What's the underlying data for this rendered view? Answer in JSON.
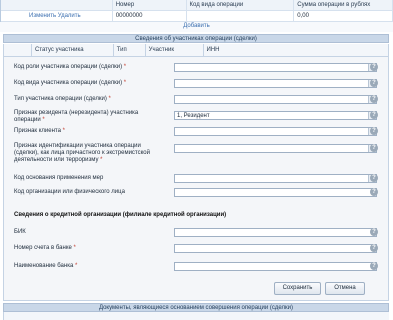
{
  "top_table": {
    "headers": [
      "",
      "Номер",
      "Код вида операции",
      "Сумма операции в рублях"
    ],
    "row": {
      "edit_link": "Изменить",
      "delete_link": "Удалить",
      "number": "00000000",
      "op_code": "",
      "amount": "0,00"
    }
  },
  "add_link": "Добавить",
  "participants_panel": {
    "title": "Сведения об участниках операции (сделки)",
    "columns": [
      "",
      "Статус участника",
      "Тип",
      "Участник",
      "ИНН"
    ]
  },
  "form": {
    "fields": [
      {
        "label": "Код роли участника операции (сделки)",
        "required": true,
        "type": "select",
        "value": ""
      },
      {
        "label": "Код вида участника операции (сделки)",
        "required": true,
        "type": "select",
        "value": ""
      },
      {
        "label": "Тип участника операции (сделки)",
        "required": true,
        "type": "select",
        "value": ""
      },
      {
        "label": "Признак резидента (нерезидента) участника операции",
        "required": true,
        "type": "select",
        "value": "1, Резидент"
      },
      {
        "label": "Признак клиента",
        "required": true,
        "type": "select",
        "value": ""
      },
      {
        "label": "Признак идентификации участника операции (сделки), как лица причастного к экстремистской деятельности или терроризму",
        "required": true,
        "type": "select",
        "value": ""
      },
      {
        "label": "Код основания применения мер",
        "required": false,
        "type": "select",
        "value": ""
      },
      {
        "label": "Код организации или физического лица",
        "required": false,
        "type": "input",
        "value": ""
      }
    ],
    "bank_section_title": "Сведения о кредитной организации (филиале кредитной организации)",
    "bank_fields": [
      {
        "label": "БИК",
        "required": false,
        "value": ""
      },
      {
        "label": "Номер счета в банке",
        "required": true,
        "value": ""
      },
      {
        "label": "Наименование банка",
        "required": true,
        "value": ""
      }
    ],
    "help_glyph": "?",
    "dropdown_glyph": "▾",
    "save_label": "Сохранить",
    "cancel_label": "Отмена"
  },
  "documents_panel": {
    "title": "Документы, являющиеся основанием совершения операции (сделки)"
  }
}
